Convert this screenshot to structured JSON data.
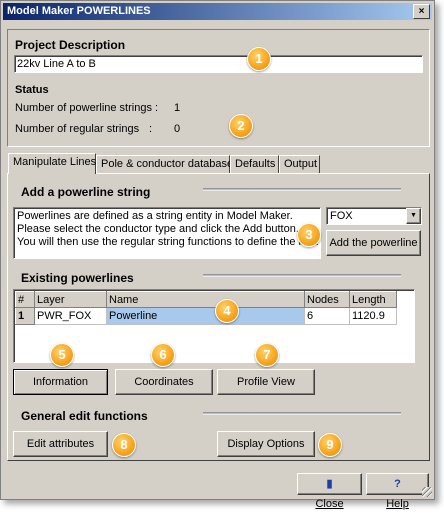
{
  "window": {
    "title": "Model Maker POWERLINES",
    "close_glyph": "×"
  },
  "project": {
    "heading": "Project Description",
    "description_value": "22kv Line A to B"
  },
  "status": {
    "heading": "Status",
    "powerline_label": "Number of powerline strings :",
    "powerline_count": "1",
    "regular_label": "Number of regular strings",
    "regular_sep": ":",
    "regular_count": "0"
  },
  "tabs": [
    {
      "label": "Manipulate Lines",
      "active": true
    },
    {
      "label": "Pole & conductor database"
    },
    {
      "label": "Defaults"
    },
    {
      "label": "Output"
    }
  ],
  "add_section": {
    "heading": "Add a powerline string",
    "info_lines": [
      "Powerlines are defined as a string entity in Model Maker.",
      "Please select the conductor type and click the Add button.",
      "You will then use the regular string functions to define the line."
    ],
    "conductor_select_value": "FOX",
    "add_button": "Add the powerline"
  },
  "existing_section": {
    "heading": "Existing powerlines",
    "columns": [
      "#",
      "Layer",
      "Name",
      "Nodes",
      "Length"
    ],
    "rows": [
      {
        "num": "1",
        "layer": "PWR_FOX",
        "name": "Powerline",
        "nodes": "6",
        "length": "1120.9"
      }
    ]
  },
  "action_buttons": {
    "information": "Information",
    "coordinates": "Coordinates",
    "profile_view": "Profile View"
  },
  "general_section": {
    "heading": "General edit functions",
    "edit_attributes": "Edit attributes",
    "display_options": "Display Options"
  },
  "footer": {
    "close_label": "Close",
    "help_label": "Help"
  },
  "badges": [
    "1",
    "2",
    "3",
    "4",
    "5",
    "6",
    "7",
    "8",
    "9"
  ]
}
